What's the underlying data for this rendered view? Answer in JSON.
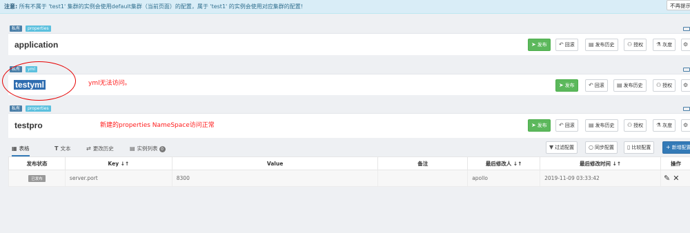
{
  "notice": {
    "label": "注意:",
    "text": "所有不属于 'test1' 集群的实例会使用default集群（当前页面）的配置，属于 'test1' 的实例会使用对应集群的配置!",
    "dismiss": "不再提示"
  },
  "namespaces": [
    {
      "tag_private": "私有",
      "tag_format": "properties",
      "name": "application",
      "buttons": {
        "publish": "发布",
        "rollback": "回滚",
        "history": "发布历史",
        "auth": "授权",
        "gray": "灰度"
      }
    },
    {
      "tag_private": "私有",
      "tag_format": "yml",
      "name": "testyml",
      "annotation": "yml无法访问。",
      "buttons": {
        "publish": "发布",
        "rollback": "回滚",
        "history": "发布历史",
        "auth": "授权"
      }
    },
    {
      "tag_private": "私有",
      "tag_format": "properties",
      "name": "testpro",
      "annotation": "新建的properties NameSpace访问正常",
      "buttons": {
        "publish": "发布",
        "rollback": "回滚",
        "history": "发布历史",
        "auth": "授权",
        "gray": "灰度"
      }
    }
  ],
  "tabs": {
    "table": "表格",
    "text": "文本",
    "history": "更改历史",
    "instances": "实例列表",
    "instances_count": "0"
  },
  "toolbar": {
    "filter": "过滤配置",
    "sync": "同步配置",
    "compare": "比较配置",
    "add": "新增配置"
  },
  "table": {
    "headers": {
      "status": "发布状态",
      "key": "Key ↓↑",
      "value": "Value",
      "comment": "备注",
      "modifier": "最后修改人 ↓↑",
      "modified_time": "最后修改时间 ↓↑",
      "ops": "操作"
    },
    "rows": [
      {
        "status": "已发布",
        "key": "server.port",
        "value": "8300",
        "comment": "",
        "modifier": "apollo",
        "modified_time": "2019-11-09 03:33:42"
      }
    ]
  },
  "colors": {
    "publish_green": "#5cb85c",
    "annotation_red": "#ff1a1a",
    "primary_blue": "#337ab7"
  }
}
